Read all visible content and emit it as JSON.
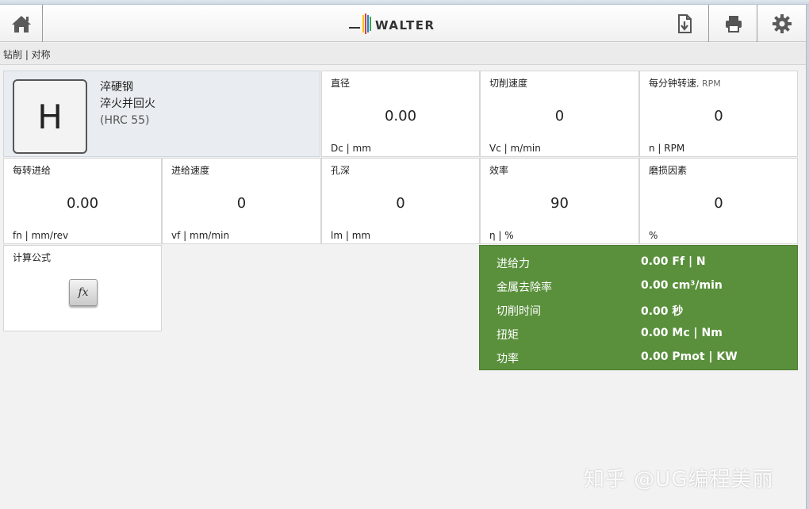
{
  "header": {
    "logo_text": "WALTER",
    "logo_colors": [
      "#f2c800",
      "#e53935",
      "#1e88e5",
      "#43a047"
    ]
  },
  "breadcrumb": "钻削 | 对称",
  "material": {
    "letter": "H",
    "name": "淬硬钢",
    "treatment": "淬火并回火",
    "hardness": "(HRC 55)"
  },
  "tiles": {
    "diameter": {
      "label": "直径",
      "value": "0.00",
      "unit": "Dc | mm"
    },
    "cutting_speed": {
      "label": "切削速度",
      "value": "0",
      "unit": "Vc | m/min"
    },
    "rpm": {
      "label": "每分钟转速",
      "label_sub": ", RPM",
      "value": "0",
      "unit": "n | RPM"
    },
    "feed_per_rev": {
      "label": "每转进给",
      "value": "0.00",
      "unit": "fn | mm/rev"
    },
    "feed_rate": {
      "label": "进给速度",
      "value": "0",
      "unit": "vf | mm/min"
    },
    "hole_depth": {
      "label": "孔深",
      "value": "0",
      "unit": "lm | mm"
    },
    "efficiency": {
      "label": "效率",
      "value": "90",
      "unit": "η | %"
    },
    "wear_factor": {
      "label": "磨损因素",
      "value": "0",
      "unit": "%"
    },
    "formula": {
      "label": "计算公式",
      "button": "fx"
    }
  },
  "results": [
    {
      "name": "进给力",
      "value": "0.00 Ff | N"
    },
    {
      "name": "金属去除率",
      "value": "0.00 cm³/min"
    },
    {
      "name": "切削时间",
      "value": "0.00 秒"
    },
    {
      "name": "扭矩",
      "value": "0.00 Mc | Nm"
    },
    {
      "name": "功率",
      "value": "0.00 Pmot | KW"
    }
  ],
  "watermark": "知乎 @UG编程美丽",
  "colors": {
    "results_bg": "#5a903c",
    "material_bg": "#e9edf1"
  }
}
